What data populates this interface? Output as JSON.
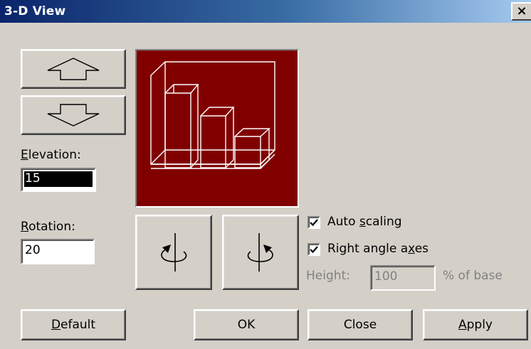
{
  "window": {
    "title": "3-D View",
    "close_glyph": "×"
  },
  "elevation": {
    "label_accel": "E",
    "label_rest": "levation:",
    "value": "15"
  },
  "rotation": {
    "label_accel": "R",
    "label_rest": "otation:",
    "value": "20"
  },
  "options": {
    "auto_scaling_pre": "Auto ",
    "auto_scaling_accel": "s",
    "auto_scaling_post": "caling",
    "auto_scaling_checked": true,
    "right_angle_pre": "Right angle a",
    "right_angle_accel": "x",
    "right_angle_post": "es",
    "right_angle_checked": true
  },
  "height": {
    "label": "Height:",
    "value": "100",
    "suffix": "% of base"
  },
  "buttons": {
    "default_accel": "D",
    "default_rest": "efault",
    "ok": "OK",
    "close": "Close",
    "apply_accel": "A",
    "apply_rest": "pply"
  },
  "icons": {
    "elevation_up": "arrow-up-icon",
    "elevation_down": "arrow-down-icon",
    "rotate_left": "rotate-left-icon",
    "rotate_right": "rotate-right-icon",
    "preview": "3d-bar-chart-preview",
    "preview_bg": "#800000"
  }
}
